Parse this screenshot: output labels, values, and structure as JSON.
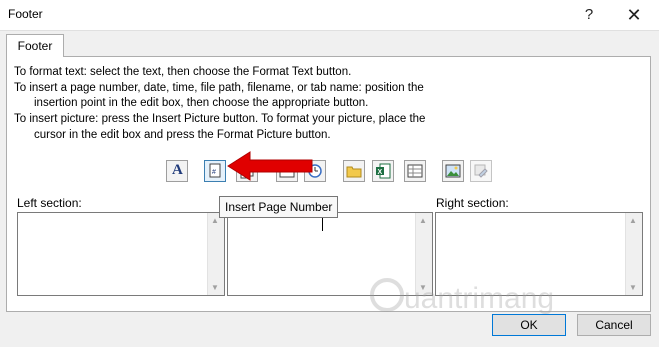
{
  "window": {
    "title": "Footer",
    "help_glyph": "?",
    "close_glyph": "✕"
  },
  "tab": {
    "label": "Footer"
  },
  "instructions": [
    "To format text:  select the text, then choose the Format Text button.",
    "To insert a page number, date, time, file path, filename, or tab name:  position the",
    "     insertion point in the edit box, then choose the appropriate button.",
    "To insert picture: press the Insert Picture button.  To format your picture, place the",
    "     cursor in the edit box and press the Format Picture button."
  ],
  "toolbar": {
    "buttons": [
      {
        "name": "format-text",
        "icon": "A"
      },
      {
        "name": "insert-page-number",
        "icon": "page-number-icon"
      },
      {
        "name": "insert-number-of-pages",
        "icon": "pages-icon"
      },
      {
        "name": "insert-date",
        "icon": "date-icon"
      },
      {
        "name": "insert-time",
        "icon": "clock-icon"
      },
      {
        "name": "insert-file-path",
        "icon": "folder-icon"
      },
      {
        "name": "insert-file-name",
        "icon": "excel-file-icon"
      },
      {
        "name": "insert-sheet-name",
        "icon": "sheet-icon"
      },
      {
        "name": "insert-picture",
        "icon": "picture-icon"
      },
      {
        "name": "format-picture",
        "icon": "format-picture-icon"
      }
    ],
    "tooltip": "Insert Page Number"
  },
  "sections": {
    "left_label": "Left section:",
    "right_label": "Right section:"
  },
  "buttons": {
    "ok": "OK",
    "cancel": "Cancel"
  },
  "watermark": "uantrimang",
  "colors": {
    "arrow": "#e00000",
    "ok_border": "#0078d7"
  }
}
